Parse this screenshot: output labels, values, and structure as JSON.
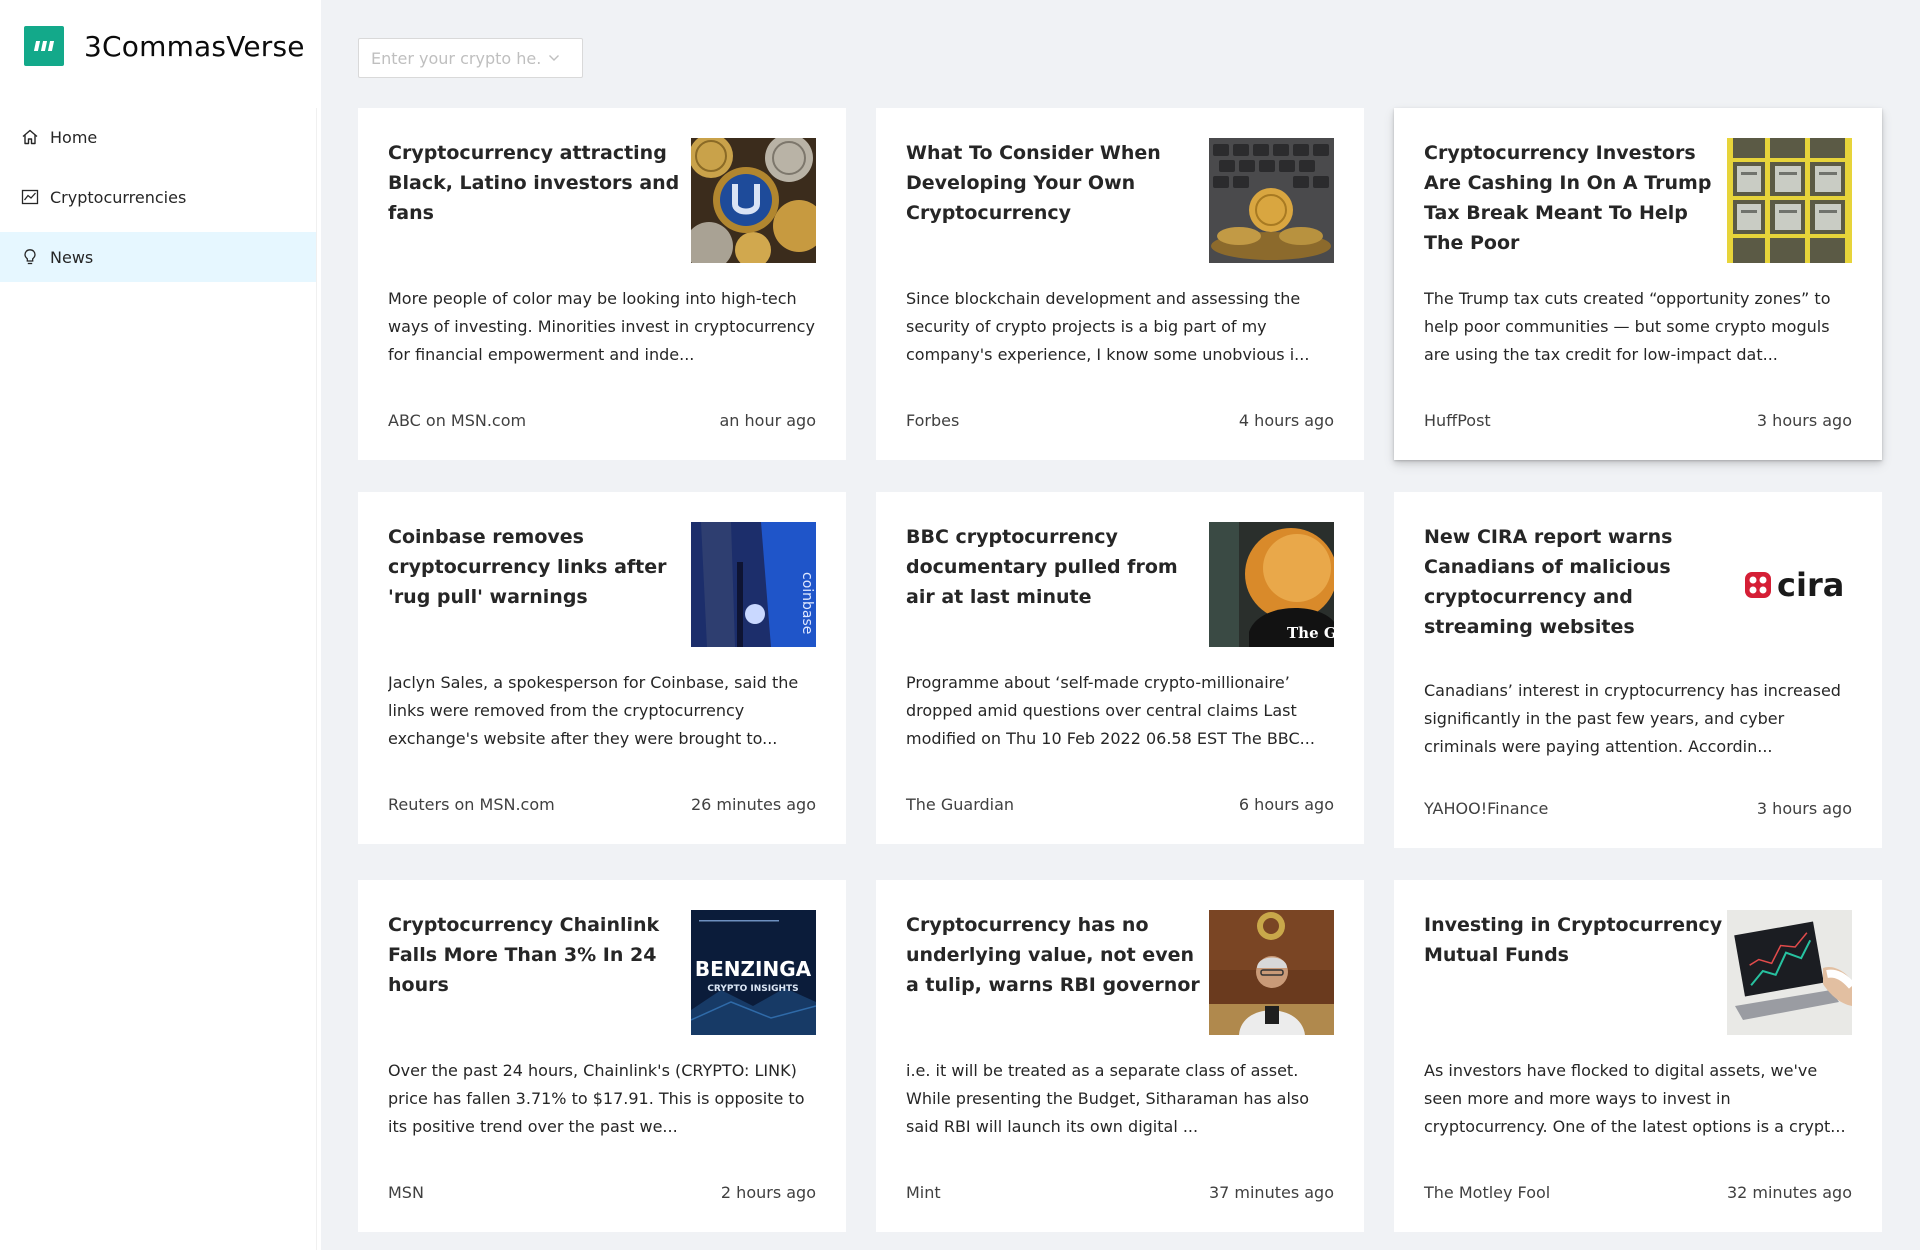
{
  "app": {
    "title": "3CommasVerse",
    "brand_color": "#13a98a"
  },
  "sidebar": {
    "items": [
      {
        "label": "Home",
        "icon": "home-icon",
        "active": false
      },
      {
        "label": "Cryptocurrencies",
        "icon": "line-chart-icon",
        "active": false
      },
      {
        "label": "News",
        "icon": "bulb-icon",
        "active": true
      }
    ]
  },
  "search": {
    "placeholder": "Enter your crypto he...",
    "value": ""
  },
  "news": [
    {
      "title": "Cryptocurrency attracting Black, Latino investors and fans",
      "description": "More people of color may be looking into high-tech ways of investing. Minorities invest in cryptocurrency for financial empowerment and inde...",
      "source": "ABC on MSN.com",
      "time": "an hour ago"
    },
    {
      "title": "What To Consider When Developing Your Own Cryptocurrency",
      "description": "Since blockchain development and assessing the security of crypto projects is a big part of my company's experience, I know some unobvious i...",
      "source": "Forbes",
      "time": "4 hours ago"
    },
    {
      "title": "Cryptocurrency Investors Are Cashing In On A Trump Tax Break Meant To Help The Poor",
      "description": "The Trump tax cuts created “opportunity zones” to help poor communities — but some crypto moguls are using the tax credit for low-impact dat...",
      "source": "HuffPost",
      "time": "3 hours ago"
    },
    {
      "title": "Coinbase removes cryptocurrency links after 'rug pull' warnings",
      "description": "Jaclyn Sales, a spokesperson for Coinbase, said the links were removed from the cryptocurrency exchange's website after they were brought to...",
      "source": "Reuters on MSN.com",
      "time": "26 minutes ago",
      "thumb_text": "coinbase"
    },
    {
      "title": "BBC cryptocurrency documentary pulled from air at last minute",
      "description": "Programme about ‘self-made crypto-millionaire’ dropped amid questions over central claims Last modified on Thu 10 Feb 2022 06.58 EST The BBC...",
      "source": "The Guardian",
      "time": "6 hours ago",
      "thumb_text": "The Guard"
    },
    {
      "title": "New CIRA report warns Canadians of malicious cryptocurrency and streaming websites",
      "description": "Canadians’ interest in cryptocurrency has increased significantly in the past few years, and cyber criminals were paying attention. Accordin...",
      "source": "YAHOO!Finance",
      "time": "3 hours ago",
      "thumb_text": "cira"
    },
    {
      "title": "Cryptocurrency Chainlink Falls More Than 3% In 24 hours",
      "description": "Over the past 24 hours, Chainlink's (CRYPTO: LINK) price has fallen 3.71% to $17.91. This is opposite to its positive trend over the past we...",
      "source": "MSN",
      "time": "2 hours ago",
      "thumb_text": "BENZINGA",
      "thumb_subtext": "CRYPTO INSIGHTS"
    },
    {
      "title": "Cryptocurrency has no underlying value, not even a tulip, warns RBI governor",
      "description": "i.e. it will be treated as a separate class of asset. While presenting the Budget, Sitharaman has also said RBI will launch its own digital ...",
      "source": "Mint",
      "time": "37 minutes ago"
    },
    {
      "title": "Investing in Cryptocurrency Mutual Funds",
      "description": "As investors have flocked to digital assets, we've seen more and more ways to invest in cryptocurrency. One of the latest options is a crypt...",
      "source": "The Motley Fool",
      "time": "32 minutes ago"
    }
  ]
}
